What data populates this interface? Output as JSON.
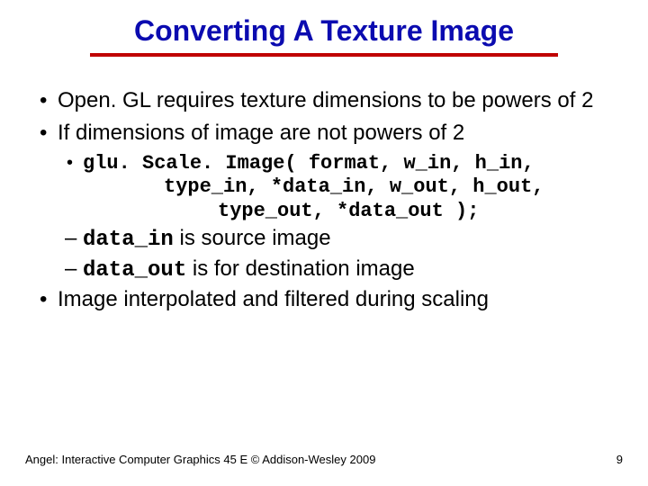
{
  "title": "Converting A Texture Image",
  "b1_1": "Open. GL requires texture dimensions to be powers of 2",
  "b1_2": "If dimensions of image are not powers of 2",
  "code_l1": "glu. Scale. Image( format, w_in, h_in,",
  "code_l2": "type_in, *data_in, w_out, h_out,",
  "code_l3": "type_out, *data_out );",
  "dash1_code": "data_in",
  "dash1_rest": " is source image",
  "dash2_code": "data_out",
  "dash2_rest": " is for destination image",
  "b1_3": "Image interpolated and filtered during scaling",
  "footer": "Angel: Interactive Computer Graphics 45 E © Addison-Wesley 2009",
  "pagenum": "9"
}
